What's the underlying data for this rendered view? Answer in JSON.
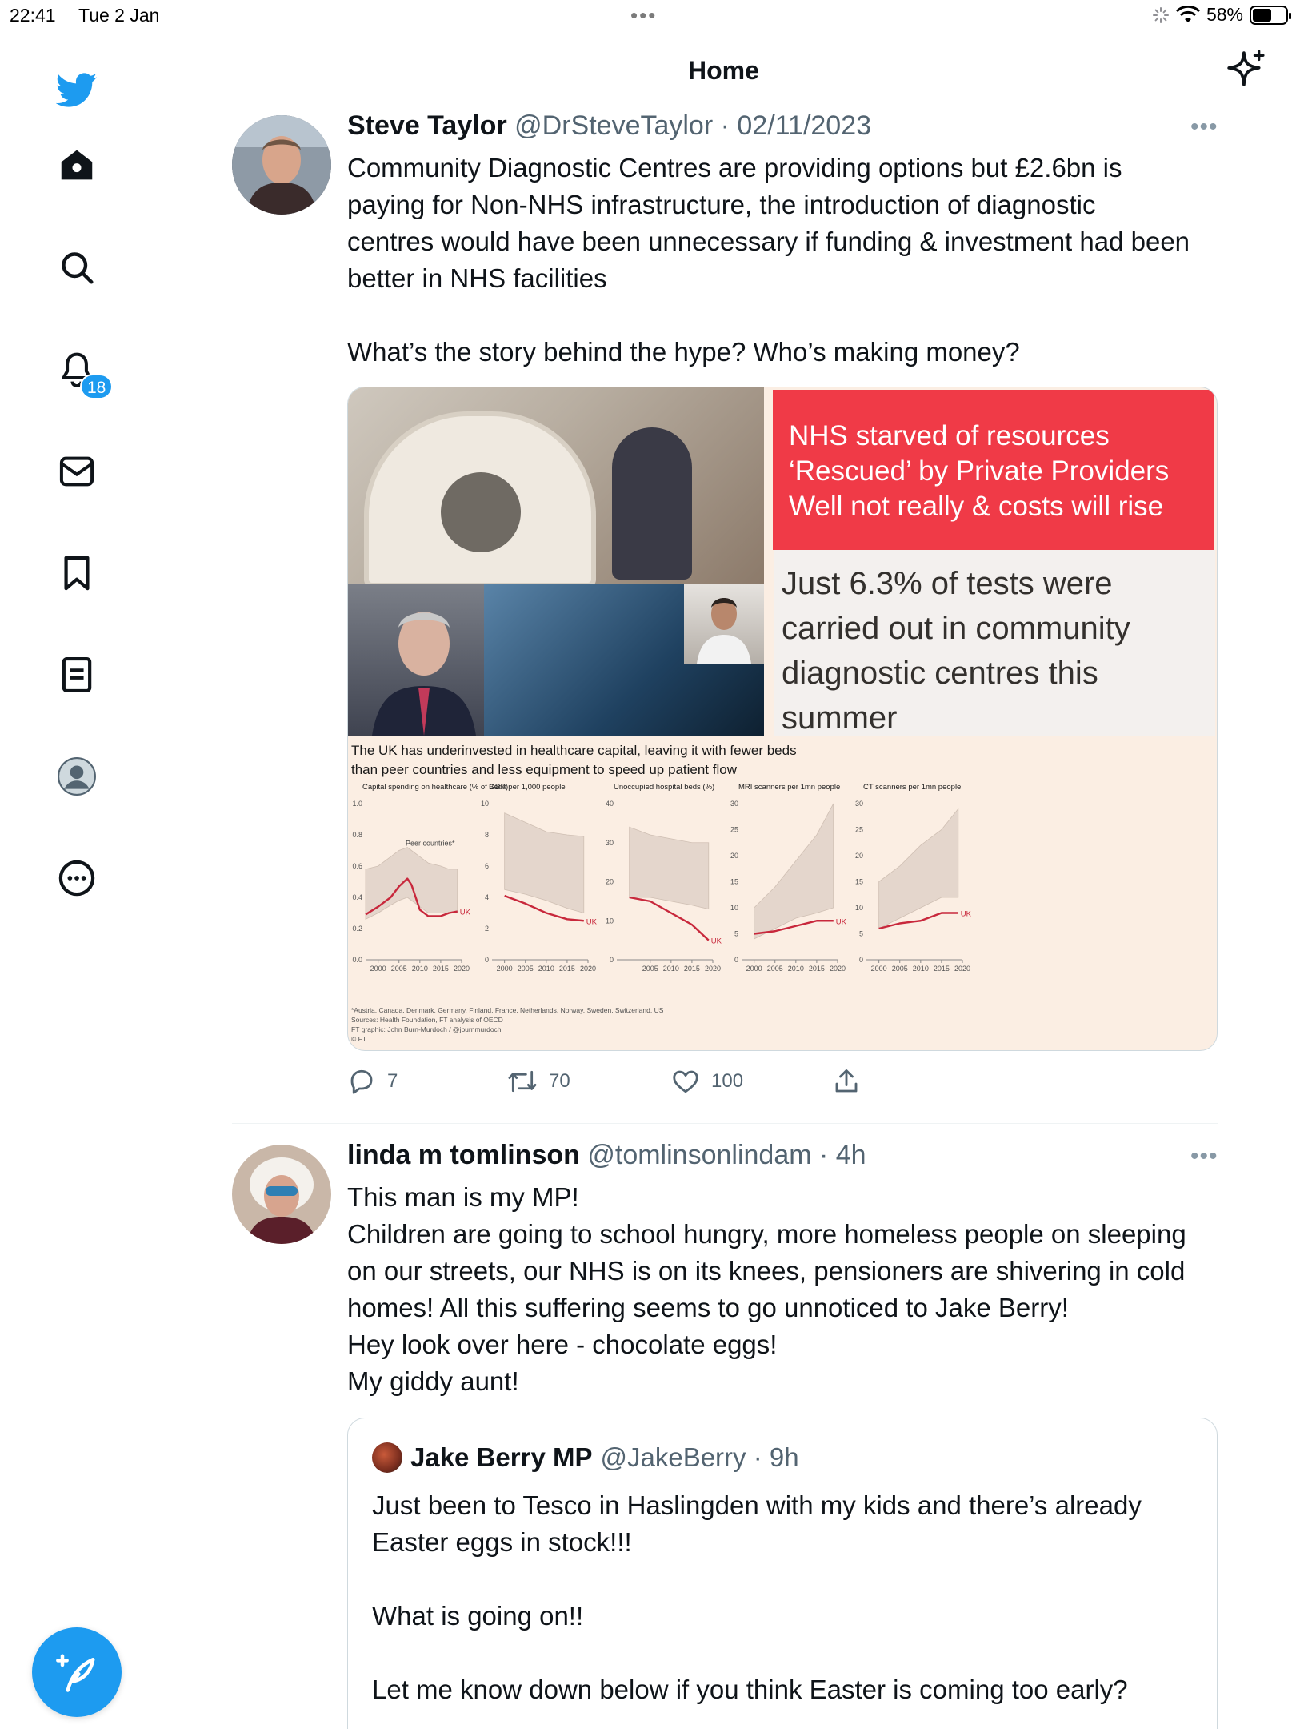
{
  "status_bar": {
    "time": "22:41",
    "date": "Tue 2 Jan",
    "dots": "•••",
    "battery": "58%",
    "battery_level": 0.58
  },
  "header": {
    "title": "Home"
  },
  "nav": {
    "items": [
      "home-icon",
      "explore-icon",
      "notifications-icon",
      "messages-icon",
      "bookmarks-icon",
      "lists-icon",
      "profile-icon",
      "more-icon"
    ],
    "notifications_badge": "18"
  },
  "tweets": [
    {
      "name": "Steve Taylor",
      "handle": "@DrSteveTaylor",
      "meta": "@DrSteveTaylor · 02/11/2023",
      "text": "Community Diagnostic Centres are providing options but £2.6bn is\npaying for Non-NHS infrastructure, the introduction of diagnostic\ncentres would have been unnecessary if funding & investment had been\nbetter in NHS facilities\n\nWhat’s the story behind the hype? Who’s making money?",
      "media": {
        "red_lines": [
          "NHS starved of resources",
          "‘Rescued’ by Private Providers",
          "Well not really & costs will rise"
        ],
        "grey_text": "Just 6.3% of tests were carried out in community diagnostic centres this summer",
        "ft_title_1": "The UK has underinvested in healthcare capital, leaving it with fewer beds",
        "ft_title_2": "than peer countries and less equipment to speed up patient flow",
        "ft_note_1": "*Austria, Canada, Denmark, Germany, Finland, France, Netherlands, Norway, Sweden, Switzerland, US",
        "ft_note_2": "Sources: Health Foundation, FT analysis of OECD",
        "ft_note_3": "FT graphic: John Burn-Murdoch / @jburnmurdoch",
        "ft_note_4": "© FT"
      },
      "actions": {
        "replies": "7",
        "retweets": "70",
        "likes": "100"
      }
    },
    {
      "name": "linda m tomlinson",
      "meta": "@tomlinsonlindam · 4h",
      "text": "This man is my MP!\nChildren are going to school hungry, more homeless people on sleeping\non our streets, our NHS is on its knees, pensioners are shivering in cold\nhomes! All this suffering seems to go unnoticed to Jake Berry!\nHey look over here - chocolate eggs!\nMy giddy aunt!",
      "quote": {
        "name": "Jake Berry MP",
        "meta": "@JakeBerry · 9h",
        "text": "Just been to Tesco in Haslingden with my kids and there’s already\nEaster eggs in stock!!!\n\nWhat is going on!!\n\nLet me know down below if you think Easter is coming too early?"
      }
    }
  ],
  "chart_data": [
    {
      "type": "line",
      "title": "Capital spending on healthcare (% of GDP)",
      "x": [
        1997,
        2000,
        2003,
        2005,
        2007,
        2008,
        2010,
        2012,
        2015,
        2017,
        2019
      ],
      "ylim": [
        0.0,
        1.0
      ],
      "yticks": [
        "0.0",
        "0.2",
        "0.4",
        "0.6",
        "0.8",
        "1.0"
      ],
      "xticks": [
        "2000",
        "2005",
        "2010",
        "2015",
        "2020"
      ],
      "band_low": [
        0.26,
        0.3,
        0.35,
        0.38,
        0.4,
        0.38,
        0.34,
        0.3,
        0.3,
        0.3,
        0.3
      ],
      "band_high": [
        0.58,
        0.6,
        0.66,
        0.7,
        0.72,
        0.7,
        0.66,
        0.62,
        0.6,
        0.58,
        0.58
      ],
      "series": [
        {
          "name": "UK",
          "values": [
            0.29,
            0.34,
            0.4,
            0.47,
            0.52,
            0.48,
            0.32,
            0.28,
            0.28,
            0.3,
            0.31
          ]
        }
      ],
      "annotations": [
        "Peer countries*"
      ]
    },
    {
      "type": "line",
      "title": "Beds per 1,000 people",
      "x": [
        2000,
        2005,
        2010,
        2015,
        2019
      ],
      "ylim": [
        0,
        10
      ],
      "yticks": [
        "0",
        "2",
        "4",
        "6",
        "8",
        "10"
      ],
      "xticks": [
        "2000",
        "2005",
        "2010",
        "2015",
        "2020"
      ],
      "band_low": [
        4.5,
        4.2,
        3.8,
        3.3,
        3.0
      ],
      "band_high": [
        9.4,
        8.8,
        8.2,
        8.0,
        7.9
      ],
      "series": [
        {
          "name": "UK",
          "values": [
            4.1,
            3.6,
            3.0,
            2.6,
            2.5
          ]
        }
      ]
    },
    {
      "type": "line",
      "title": "Unoccupied hospital beds (%)",
      "x": [
        2000,
        2005,
        2010,
        2015,
        2019
      ],
      "ylim": [
        0,
        40
      ],
      "yticks": [
        "0",
        "10",
        "20",
        "30",
        "40"
      ],
      "xticks": [
        "2005",
        "2010",
        "2015",
        "2020"
      ],
      "band_low": [
        16,
        16,
        15,
        14,
        13
      ],
      "band_high": [
        34,
        32,
        31,
        30,
        30
      ],
      "series": [
        {
          "name": "UK",
          "values": [
            16,
            15,
            12,
            9,
            5
          ]
        }
      ]
    },
    {
      "type": "line",
      "title": "MRI scanners per 1mn people",
      "x": [
        2000,
        2005,
        2010,
        2015,
        2019
      ],
      "ylim": [
        0,
        30
      ],
      "yticks": [
        "0",
        "5",
        "10",
        "15",
        "20",
        "25",
        "30"
      ],
      "xticks": [
        "2000",
        "2005",
        "2010",
        "2015",
        "2020"
      ],
      "band_low": [
        4,
        6,
        8,
        9,
        10
      ],
      "band_high": [
        10,
        14,
        19,
        24,
        30
      ],
      "series": [
        {
          "name": "UK",
          "values": [
            5,
            5.5,
            6.5,
            7.5,
            7.5
          ]
        }
      ]
    },
    {
      "type": "line",
      "title": "CT scanners per 1mn people",
      "x": [
        2000,
        2005,
        2010,
        2015,
        2019
      ],
      "ylim": [
        0,
        30
      ],
      "yticks": [
        "0",
        "5",
        "10",
        "15",
        "20",
        "25",
        "30"
      ],
      "xticks": [
        "2000",
        "2005",
        "2010",
        "2015",
        "2020"
      ],
      "band_low": [
        6,
        8,
        10,
        12,
        12
      ],
      "band_high": [
        15,
        18,
        22,
        25,
        29
      ],
      "series": [
        {
          "name": "UK",
          "values": [
            6,
            7,
            7.5,
            9,
            9
          ]
        }
      ]
    }
  ]
}
